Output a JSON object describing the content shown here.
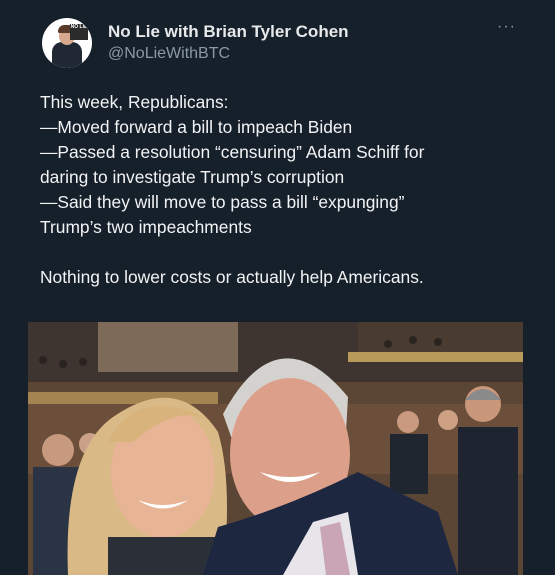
{
  "tweet": {
    "author_name": "No Lie with Brian Tyler Cohen",
    "author_handle": "@NoLieWithBTC",
    "avatar_badge": "NO LIE",
    "more_label": "···",
    "lines": [
      "This week, Republicans:",
      "—Moved forward a bill to impeach Biden",
      "—Passed a resolution “censuring” Adam Schiff for",
      "daring to investigate Trump’s corruption",
      "—Said they will move to pass a bill “expunging”",
      "Trump’s two impeachments"
    ],
    "closing_line": "Nothing to lower costs or actually help Americans."
  },
  "colors": {
    "background": "#15202b",
    "text": "#e7e9ea",
    "secondary": "#8b98a5"
  }
}
